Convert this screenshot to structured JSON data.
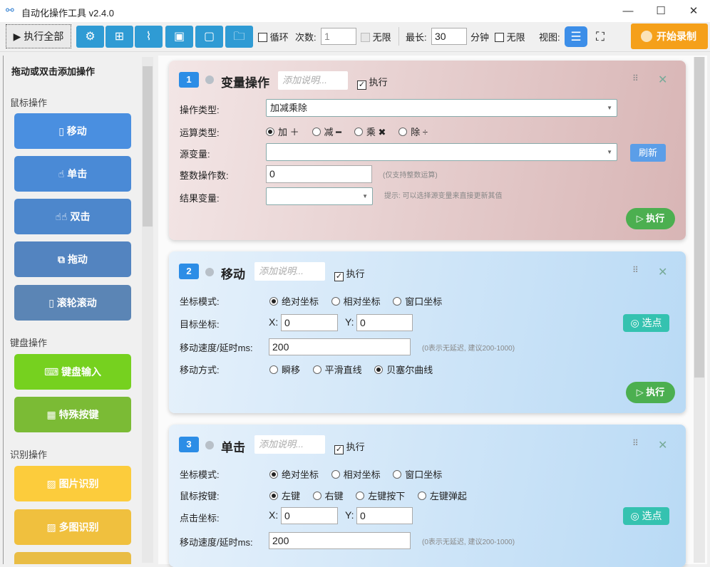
{
  "window": {
    "title": "自动化操作工具 v2.4.0",
    "minimize": "—",
    "maximize": "☐",
    "close": "✕"
  },
  "toolbar": {
    "run_all": "▶ 执行全部",
    "icons": [
      "gear-icon",
      "new-folder-icon",
      "broom-icon",
      "save-icon",
      "save-as-icon",
      "open-folder-icon"
    ],
    "loop_label": "循环",
    "count_label": "次数:",
    "count_value": "1",
    "unlimited1": "无限",
    "max_label": "最长:",
    "max_value": "30",
    "minutes": "分钟",
    "unlimited2": "无限",
    "view_label": "视图:",
    "record": "开始录制"
  },
  "sidebar": {
    "title": "拖动或双击添加操作",
    "sections": [
      {
        "label": "鼠标操作",
        "items": [
          "移动",
          "单击",
          "双击",
          "拖动",
          "滚轮滚动"
        ]
      },
      {
        "label": "键盘操作",
        "items": [
          "键盘输入",
          "特殊按键"
        ]
      },
      {
        "label": "识别操作",
        "items": [
          "图片识别",
          "多图识别"
        ]
      }
    ]
  },
  "cards": [
    {
      "num": "1",
      "title": "变量操作",
      "desc_placeholder": "添加说明...",
      "exec_check": "执行",
      "op_type_label": "操作类型:",
      "op_type_value": "加减乘除",
      "calc_label": "运算类型:",
      "calc_options": [
        "加 ＋",
        "减 ━",
        "乘 ✖",
        "除 ÷"
      ],
      "src_label": "源变量:",
      "refresh": "刷新",
      "int_label": "整数操作数:",
      "int_value": "0",
      "int_hint": "(仅支持整数运算)",
      "result_label": "结果变量:",
      "result_hint": "提示: 可以选择源变量来直接更新其值",
      "exec_btn": "▷ 执行"
    },
    {
      "num": "2",
      "title": "移动",
      "desc_placeholder": "添加说明...",
      "exec_check": "执行",
      "coord_mode_label": "坐标模式:",
      "coord_modes": [
        "绝对坐标",
        "相对坐标",
        "窗口坐标"
      ],
      "target_label": "目标坐标:",
      "x_label": "X:",
      "x_value": "0",
      "y_label": "Y:",
      "y_value": "0",
      "pick": "选点",
      "speed_label": "移动速度/延时ms:",
      "speed_value": "200",
      "speed_hint": "(0表示无延迟, 建议200-1000)",
      "move_label": "移动方式:",
      "move_modes": [
        "瞬移",
        "平滑直线",
        "贝塞尔曲线"
      ],
      "exec_btn": "▷ 执行"
    },
    {
      "num": "3",
      "title": "单击",
      "desc_placeholder": "添加说明...",
      "exec_check": "执行",
      "coord_mode_label": "坐标模式:",
      "coord_modes": [
        "绝对坐标",
        "相对坐标",
        "窗口坐标"
      ],
      "button_label": "鼠标按键:",
      "buttons": [
        "左键",
        "右键",
        "左键按下",
        "左键弹起"
      ],
      "click_label": "点击坐标:",
      "x_label": "X:",
      "x_value": "0",
      "y_label": "Y:",
      "y_value": "0",
      "pick": "选点",
      "speed_label": "移动速度/延时ms:",
      "speed_value": "200",
      "speed_hint": "(0表示无延迟, 建议200-1000)"
    }
  ]
}
